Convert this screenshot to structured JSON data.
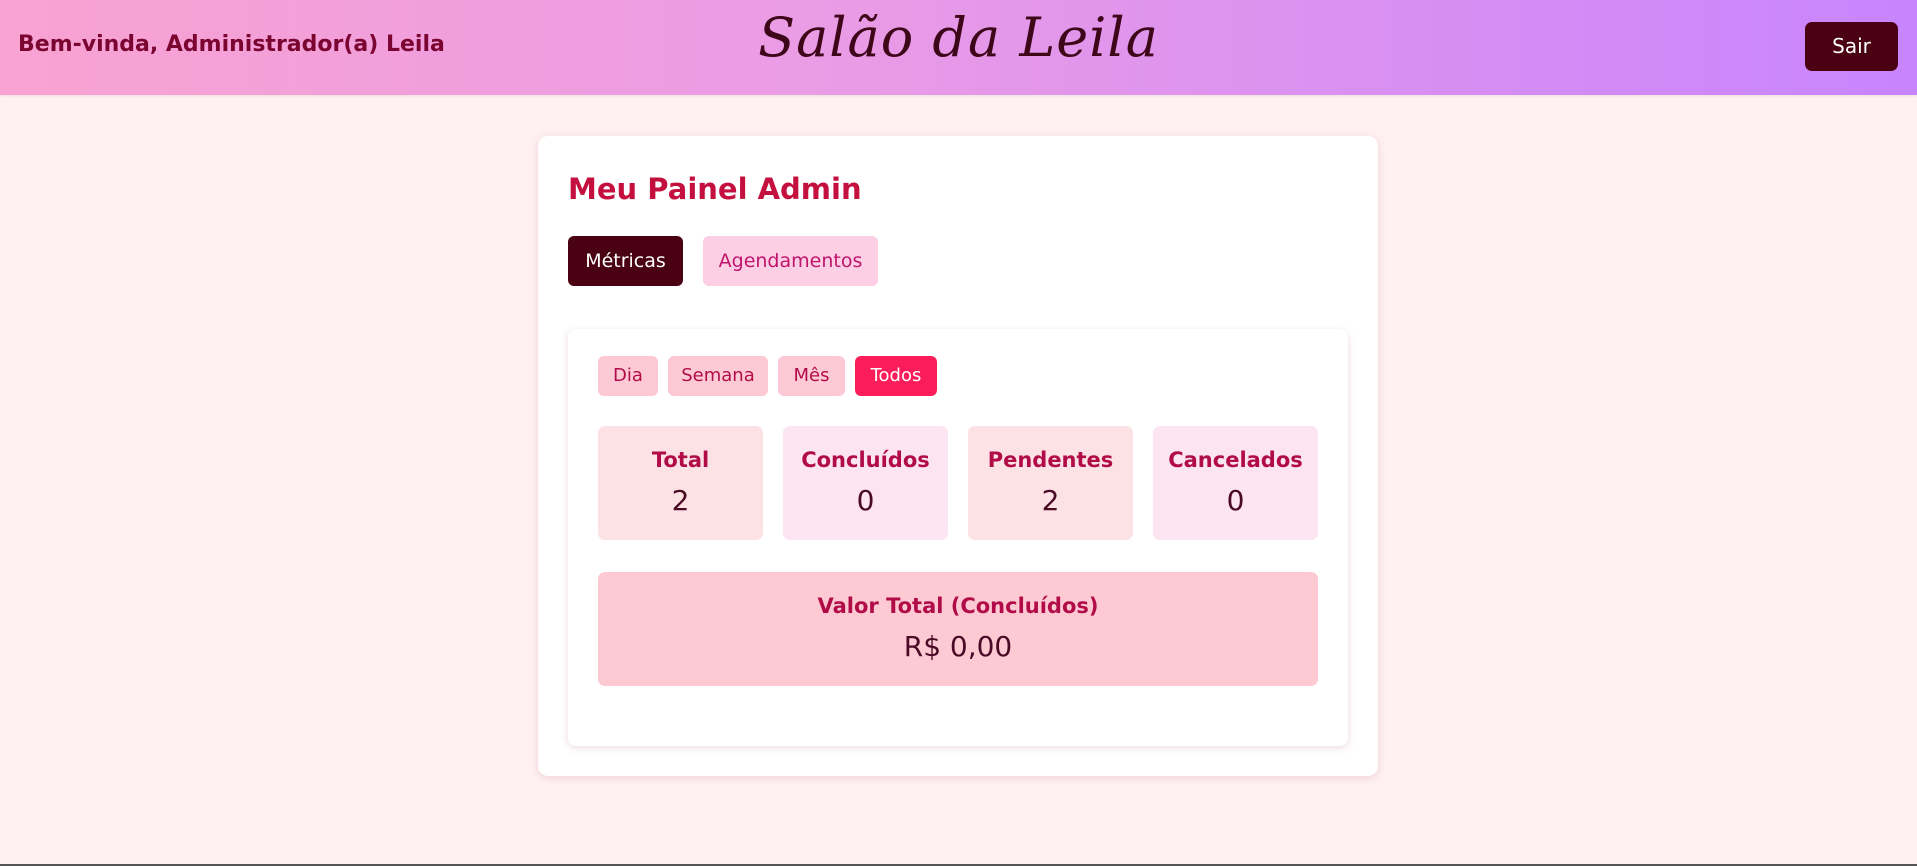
{
  "header": {
    "welcome": "Bem-vinda, Administrador(a) Leila",
    "brand": "Salão da Leila",
    "logout_label": "Sair"
  },
  "panel": {
    "title": "Meu Painel Admin",
    "tabs": [
      {
        "label": "Métricas",
        "active": true
      },
      {
        "label": "Agendamentos",
        "active": false
      }
    ],
    "filters": [
      {
        "label": "Dia",
        "active": false
      },
      {
        "label": "Semana",
        "active": false
      },
      {
        "label": "Mês",
        "active": false
      },
      {
        "label": "Todos",
        "active": true
      }
    ],
    "stats": [
      {
        "label": "Total",
        "value": "2"
      },
      {
        "label": "Concluídos",
        "value": "0"
      },
      {
        "label": "Pendentes",
        "value": "2"
      },
      {
        "label": "Cancelados",
        "value": "0"
      }
    ],
    "summary": {
      "label": "Valor Total (Concluídos)",
      "value": "R$ 0,00"
    }
  },
  "colors": {
    "header_gradient_start": "#f9a3d2",
    "header_gradient_end": "#c884fd",
    "dark_accent": "#4a0213",
    "active_filter": "#fb1d5a",
    "title": "#c4103f",
    "page_background": "#fff0f1"
  }
}
